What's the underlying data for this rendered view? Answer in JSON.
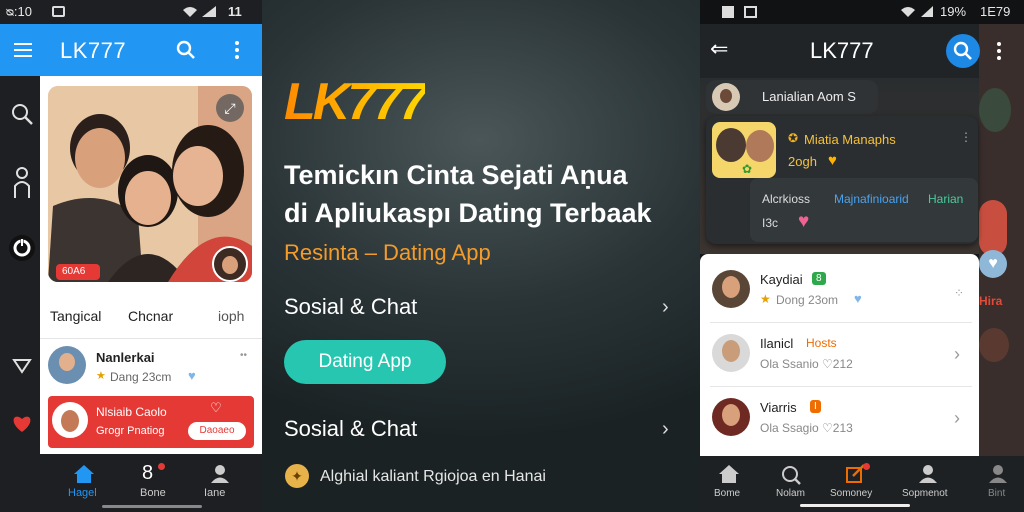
{
  "colors": {
    "primary": "#2196f3",
    "accent_teal": "#26c6b0",
    "brand_orange": "#ff8a00",
    "brand_yellow": "#ffc400",
    "red": "#e53935",
    "subtitle_orange": "#f39b2b"
  },
  "left_phone": {
    "status": {
      "time": "ᴓ:10",
      "battery": "11"
    },
    "appbar": {
      "title": "LK777",
      "menu_icon": "hamburger-icon",
      "search_icon": "search-icon",
      "more_icon": "more-vert-icon"
    },
    "sidebar_icons": [
      "search-icon",
      "person-icon",
      "power-icon",
      "triangle-down-icon",
      "heart-icon"
    ],
    "hero": {
      "badge": "60A6",
      "expand_icon": "expand-icon"
    },
    "tabs": [
      "Tangical",
      "Chcnar",
      "ioph"
    ],
    "profile": {
      "name": "Nanlerkai",
      "meta": "Dang 23cm"
    },
    "promo": {
      "title": "Nlsiaib Caolo",
      "subtitle": "Grogr Pnatiog",
      "button": "Daoaeo"
    },
    "bottom_nav": [
      {
        "label": "Hagel",
        "icon": "home-icon",
        "active": true
      },
      {
        "label": "Bone",
        "icon": "chat-icon",
        "active": false
      },
      {
        "label": "Iane",
        "icon": "profile-icon",
        "active": false
      }
    ]
  },
  "center": {
    "logo": "LK777",
    "headline_line1": "Temickın Cinta Sejati Aṇua",
    "headline_line2": "di Apliukaspı Dating Terbaak",
    "subtitle": "Resinta – Dating App",
    "row1_label": "Sosial & Chat",
    "pill_label": "Dating App",
    "row2_label": "Sosial & Chat",
    "footer_text": "Alghial kaliant Rgiojoa en Hanai"
  },
  "right_phone": {
    "status": {
      "battery": "19%",
      "time": "1E79"
    },
    "appbar": {
      "title": "LK777",
      "back_icon": "back-arrow-icon",
      "search_icon": "search-icon",
      "more_icon": "more-vert-icon"
    },
    "bubble1": "Lanialian Aom S",
    "card": {
      "name": "Miatia Manaphs",
      "sub": "2ogh",
      "line2_a": "Alcrkioss",
      "line2_b": "Majnafinioarid",
      "line2_c": "Harian",
      "line3": "I3c"
    },
    "right_strip_text": "Hira",
    "list": [
      {
        "name": "Kaydiai",
        "tag": "8",
        "sub": "Dong 23om"
      },
      {
        "name": "Ilanicl",
        "tag": "Hosts",
        "sub": "Ola Ssanio ♡212"
      },
      {
        "name": "Viarris",
        "tag": "I",
        "sub": "Ola Ssagio ♡213"
      }
    ],
    "bottom_nav": [
      "Bome",
      "Nolam",
      "Somoney",
      "Sopmenot",
      "Bint"
    ]
  }
}
